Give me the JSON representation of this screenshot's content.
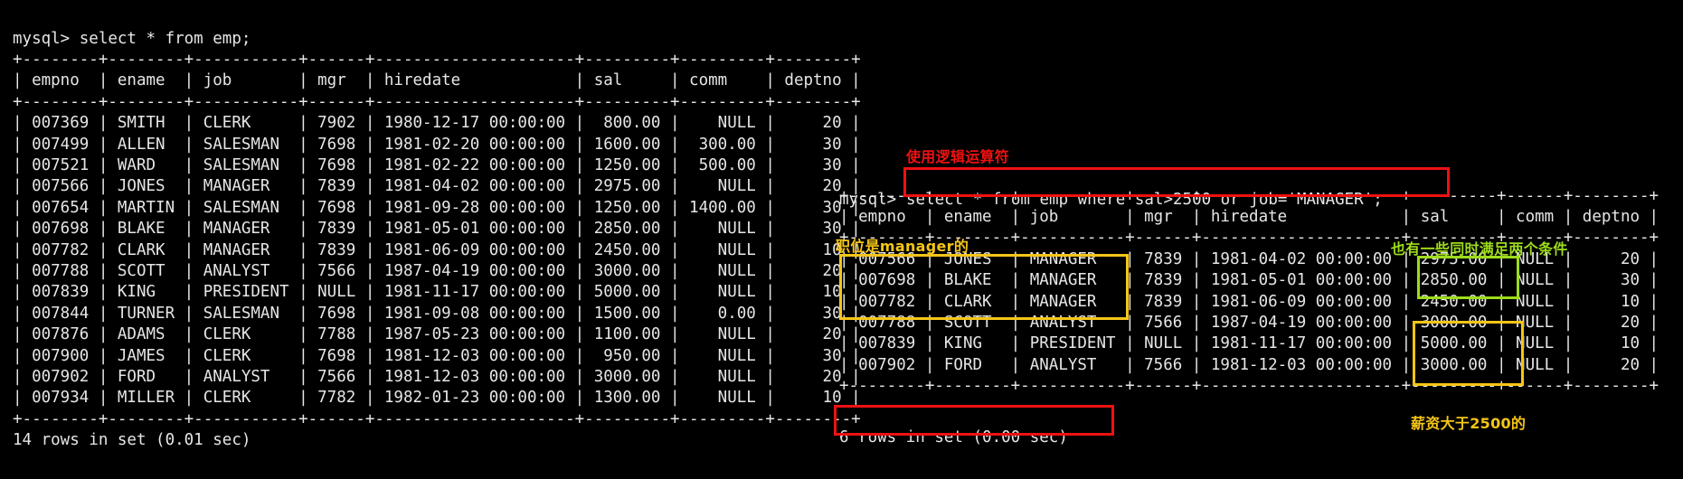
{
  "terminal": {
    "left_pane": {
      "prompt_line": "mysql> select * from emp;",
      "block": "mysql> select * from emp;\n+--------+--------+-----------+------+---------------------+---------+---------+--------+\n| empno  | ename  | job       | mgr  | hiredate            | sal     | comm    | deptno |\n+--------+--------+-----------+------+---------------------+---------+---------+--------+\n| 007369 | SMITH  | CLERK     | 7902 | 1980-12-17 00:00:00 |  800.00 |    NULL |     20 |\n| 007499 | ALLEN  | SALESMAN  | 7698 | 1981-02-20 00:00:00 | 1600.00 |  300.00 |     30 |\n| 007521 | WARD   | SALESMAN  | 7698 | 1981-02-22 00:00:00 | 1250.00 |  500.00 |     30 |\n| 007566 | JONES  | MANAGER   | 7839 | 1981-04-02 00:00:00 | 2975.00 |    NULL |     20 |\n| 007654 | MARTIN | SALESMAN  | 7698 | 1981-09-28 00:00:00 | 1250.00 | 1400.00 |     30 |\n| 007698 | BLAKE  | MANAGER   | 7839 | 1981-05-01 00:00:00 | 2850.00 |    NULL |     30 |\n| 007782 | CLARK  | MANAGER   | 7839 | 1981-06-09 00:00:00 | 2450.00 |    NULL |     10 |\n| 007788 | SCOTT  | ANALYST   | 7566 | 1987-04-19 00:00:00 | 3000.00 |    NULL |     20 |\n| 007839 | KING   | PRESIDENT | NULL | 1981-11-17 00:00:00 | 5000.00 |    NULL |     10 |\n| 007844 | TURNER | SALESMAN  | 7698 | 1981-09-08 00:00:00 | 1500.00 |    0.00 |     30 |\n| 007876 | ADAMS  | CLERK     | 7788 | 1987-05-23 00:00:00 | 1100.00 |    NULL |     20 |\n| 007900 | JAMES  | CLERK     | 7698 | 1981-12-03 00:00:00 |  950.00 |    NULL |     30 |\n| 007902 | FORD   | ANALYST   | 7566 | 1981-12-03 00:00:00 | 3000.00 |    NULL |     20 |\n| 007934 | MILLER | CLERK     | 7782 | 1982-01-23 00:00:00 | 1300.00 |    NULL |     10 |\n+--------+--------+-----------+------+---------------------+---------+---------+--------+\n14 rows in set (0.01 sec)",
      "columns": [
        "empno",
        "ename",
        "job",
        "mgr",
        "hiredate",
        "sal",
        "comm",
        "deptno"
      ],
      "rows": [
        [
          "007369",
          "SMITH",
          "CLERK",
          "7902",
          "1980-12-17 00:00:00",
          "800.00",
          "NULL",
          "20"
        ],
        [
          "007499",
          "ALLEN",
          "SALESMAN",
          "7698",
          "1981-02-20 00:00:00",
          "1600.00",
          "300.00",
          "30"
        ],
        [
          "007521",
          "WARD",
          "SALESMAN",
          "7698",
          "1981-02-22 00:00:00",
          "1250.00",
          "500.00",
          "30"
        ],
        [
          "007566",
          "JONES",
          "MANAGER",
          "7839",
          "1981-04-02 00:00:00",
          "2975.00",
          "NULL",
          "20"
        ],
        [
          "007654",
          "MARTIN",
          "SALESMAN",
          "7698",
          "1981-09-28 00:00:00",
          "1250.00",
          "1400.00",
          "30"
        ],
        [
          "007698",
          "BLAKE",
          "MANAGER",
          "7839",
          "1981-05-01 00:00:00",
          "2850.00",
          "NULL",
          "30"
        ],
        [
          "007782",
          "CLARK",
          "MANAGER",
          "7839",
          "1981-06-09 00:00:00",
          "2450.00",
          "NULL",
          "10"
        ],
        [
          "007788",
          "SCOTT",
          "ANALYST",
          "7566",
          "1987-04-19 00:00:00",
          "3000.00",
          "NULL",
          "20"
        ],
        [
          "007839",
          "KING",
          "PRESIDENT",
          "NULL",
          "1981-11-17 00:00:00",
          "5000.00",
          "NULL",
          "10"
        ],
        [
          "007844",
          "TURNER",
          "SALESMAN",
          "7698",
          "1981-09-08 00:00:00",
          "1500.00",
          "0.00",
          "30"
        ],
        [
          "007876",
          "ADAMS",
          "CLERK",
          "7788",
          "1987-05-23 00:00:00",
          "1100.00",
          "NULL",
          "20"
        ],
        [
          "007900",
          "JAMES",
          "CLERK",
          "7698",
          "1981-12-03 00:00:00",
          "950.00",
          "NULL",
          "30"
        ],
        [
          "007902",
          "FORD",
          "ANALYST",
          "7566",
          "1981-12-03 00:00:00",
          "3000.00",
          "NULL",
          "20"
        ],
        [
          "007934",
          "MILLER",
          "CLERK",
          "7782",
          "1982-01-23 00:00:00",
          "1300.00",
          "NULL",
          "10"
        ]
      ],
      "status": "14 rows in set (0.01 sec)"
    },
    "right_pane": {
      "prompt": "mysql> ",
      "query": "select * from emp where sal>2500 or job='MANAGER';",
      "block": "+--------+--------+-----------+------+---------------------+---------+------+--------+\n| empno  | ename  | job       | mgr  | hiredate            | sal     | comm | deptno |\n+--------+--------+-----------+------+---------------------+---------+------+--------+\n| 007566 | JONES  | MANAGER   | 7839 | 1981-04-02 00:00:00 | 2975.00 | NULL |     20 |\n| 007698 | BLAKE  | MANAGER   | 7839 | 1981-05-01 00:00:00 | 2850.00 | NULL |     30 |\n| 007782 | CLARK  | MANAGER   | 7839 | 1981-06-09 00:00:00 | 2450.00 | NULL |     10 |\n| 007788 | SCOTT  | ANALYST   | 7566 | 1987-04-19 00:00:00 | 3000.00 | NULL |     20 |\n| 007839 | KING   | PRESIDENT | NULL | 1981-11-17 00:00:00 | 5000.00 | NULL |     10 |\n| 007902 | FORD   | ANALYST   | 7566 | 1981-12-03 00:00:00 | 3000.00 | NULL |     20 |\n+--------+--------+-----------+------+---------------------+---------+------+--------+",
      "columns": [
        "empno",
        "ename",
        "job",
        "mgr",
        "hiredate",
        "sal",
        "comm",
        "deptno"
      ],
      "rows": [
        [
          "007566",
          "JONES",
          "MANAGER",
          "7839",
          "1981-04-02 00:00:00",
          "2975.00",
          "NULL",
          "20"
        ],
        [
          "007698",
          "BLAKE",
          "MANAGER",
          "7839",
          "1981-05-01 00:00:00",
          "2850.00",
          "NULL",
          "30"
        ],
        [
          "007782",
          "CLARK",
          "MANAGER",
          "7839",
          "1981-06-09 00:00:00",
          "2450.00",
          "NULL",
          "10"
        ],
        [
          "007788",
          "SCOTT",
          "ANALYST",
          "7566",
          "1987-04-19 00:00:00",
          "3000.00",
          "NULL",
          "20"
        ],
        [
          "007839",
          "KING",
          "PRESIDENT",
          "NULL",
          "1981-11-17 00:00:00",
          "5000.00",
          "NULL",
          "10"
        ],
        [
          "007902",
          "FORD",
          "ANALYST",
          "7566",
          "1981-12-03 00:00:00",
          "3000.00",
          "NULL",
          "20"
        ]
      ],
      "status": "6 rows in set (0.00 sec)"
    }
  },
  "annotations": {
    "logical_operator": {
      "text": "使用逻辑运算符",
      "color": "#ee1111"
    },
    "manager_job": {
      "text": "职位是manager的",
      "color": "#f5c518"
    },
    "both_conditions": {
      "text": "也有一些同时满足两个条件",
      "color": "#9ddc1b"
    },
    "salary_gt_2500": {
      "text": "薪资大于2500的",
      "color": "#f5c518"
    }
  },
  "colors": {
    "background": "#000000",
    "text": "#e6e6e6",
    "red": "#ee1111",
    "yellow": "#f5c518",
    "green": "#9ddc1b"
  }
}
